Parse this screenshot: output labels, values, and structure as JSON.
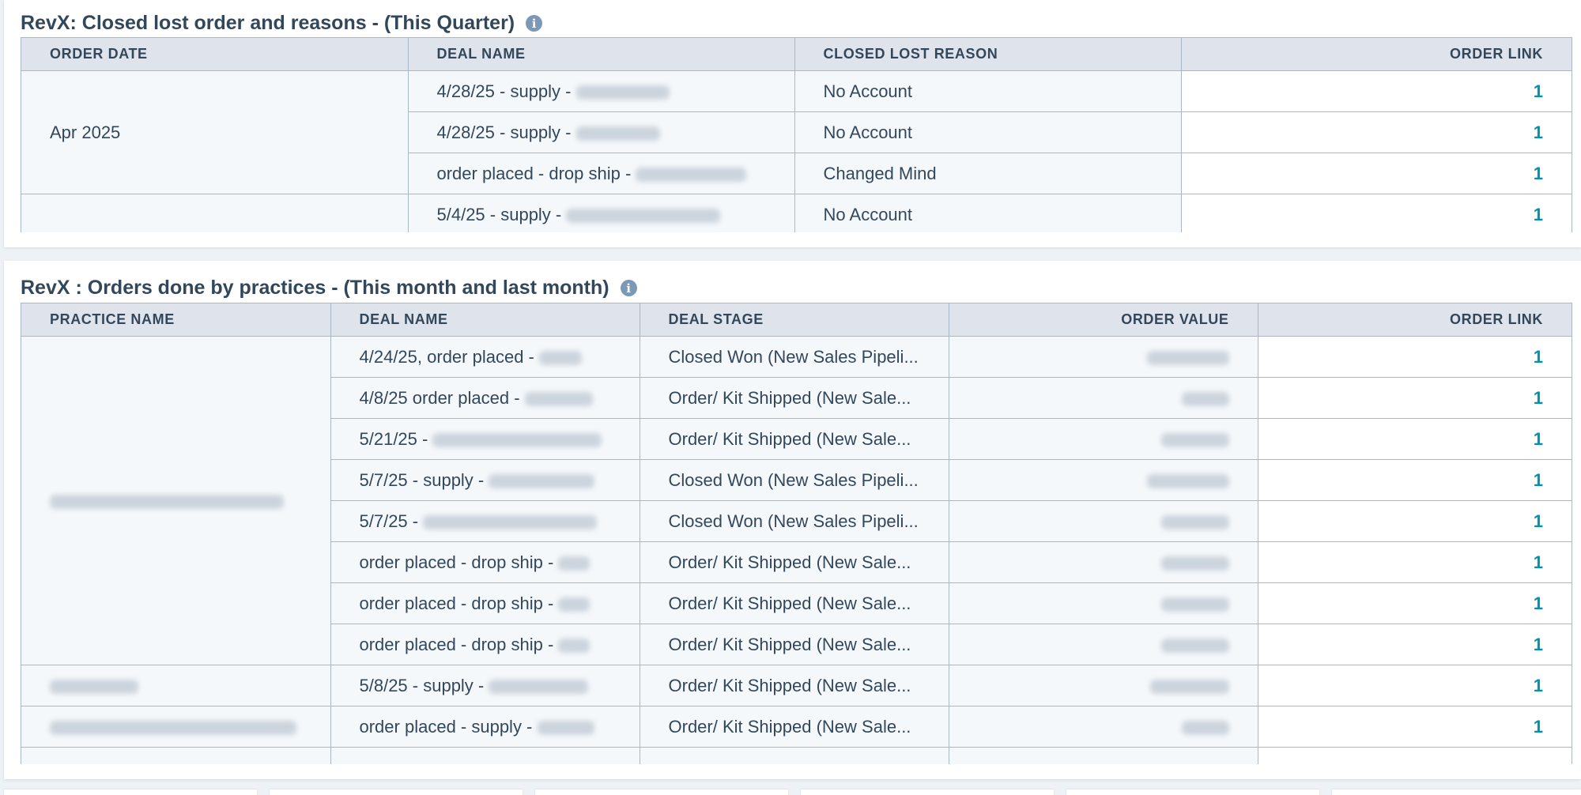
{
  "report1": {
    "title": "RevX: Closed lost order and reasons - (This Quarter)",
    "columns": [
      "ORDER DATE",
      "DEAL NAME",
      "CLOSED LOST REASON",
      "ORDER LINK"
    ],
    "group_label": "Apr 2025",
    "rows": [
      {
        "deal": "4/28/25 - supply -",
        "reason": "No Account",
        "link": "1"
      },
      {
        "deal": "4/28/25 - supply -",
        "reason": "No Account",
        "link": "1"
      },
      {
        "deal": "order placed - drop ship -",
        "reason": "Changed Mind",
        "link": "1"
      },
      {
        "deal": "5/4/25 - supply -",
        "reason": "No Account",
        "link": "1"
      }
    ]
  },
  "report2": {
    "title": "RevX : Orders done by practices - (This month and last month)",
    "columns": [
      "PRACTICE NAME",
      "DEAL NAME",
      "DEAL STAGE",
      "ORDER VALUE",
      "ORDER LINK"
    ],
    "rows": [
      {
        "deal": "4/24/25, order placed -",
        "stage": "Closed Won (New Sales Pipeli...",
        "link": "1"
      },
      {
        "deal": "4/8/25 order placed -",
        "stage": "Order/ Kit Shipped (New Sale...",
        "link": "1"
      },
      {
        "deal": "5/21/25 -",
        "stage": "Order/ Kit Shipped (New Sale...",
        "link": "1"
      },
      {
        "deal": "5/7/25 - supply -",
        "stage": "Closed Won (New Sales Pipeli...",
        "link": "1"
      },
      {
        "deal": "5/7/25 -",
        "stage": "Closed Won (New Sales Pipeli...",
        "link": "1"
      },
      {
        "deal": "order placed - drop ship -",
        "stage": "Order/ Kit Shipped (New Sale...",
        "link": "1"
      },
      {
        "deal": "order placed - drop ship -",
        "stage": "Order/ Kit Shipped (New Sale...",
        "link": "1"
      },
      {
        "deal": "order placed - drop ship -",
        "stage": "Order/ Kit Shipped (New Sale...",
        "link": "1"
      },
      {
        "deal": "5/8/25 - supply -",
        "stage": "Order/ Kit Shipped (New Sale...",
        "link": "1"
      },
      {
        "deal": "order placed - supply -",
        "stage": "Order/ Kit Shipped (New Sale...",
        "link": "1"
      }
    ]
  },
  "icons": {
    "info": "info-icon"
  },
  "colors": {
    "link": "#0091ae",
    "header_bg": "#dfe3eb",
    "text": "#33475b",
    "border": "#a9b8c9"
  }
}
